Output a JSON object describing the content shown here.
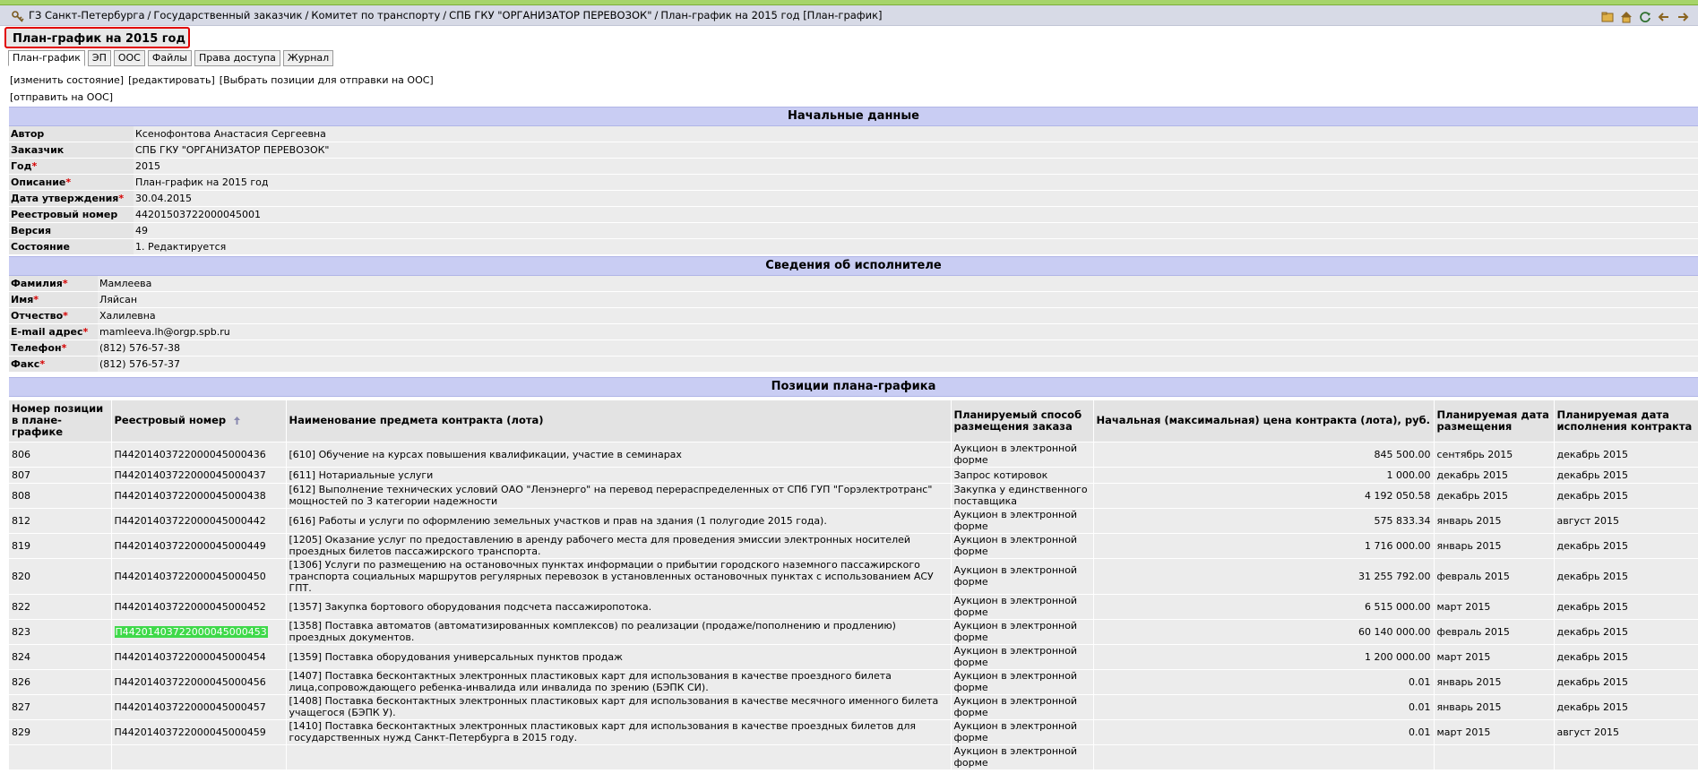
{
  "breadcrumbs": [
    "ГЗ Санкт-Петербурга",
    "Государственный заказчик",
    "Комитет по транспорту",
    "СПБ ГКУ \"ОРГАНИЗАТОР ПЕРЕВОЗОК\"",
    "План-график на 2015 год [План-график]"
  ],
  "breadcrumb_sep": "/",
  "toolbar_icons": [
    "folder-icon",
    "home-icon",
    "refresh-icon",
    "back-icon",
    "forward-icon"
  ],
  "page_title": "План-график на 2015 год",
  "tabs": [
    "План-график",
    "ЭП",
    "ООС",
    "Файлы",
    "Права доступа",
    "Журнал"
  ],
  "active_tab": "План-график",
  "actions": [
    "[изменить состояние]",
    "[редактировать]",
    "[Выбрать позиции для отправки на ООС]"
  ],
  "actions_row2": "[отправить на ООС]",
  "initial_data": {
    "title": "Начальные данные",
    "rows": [
      {
        "label": "Автор",
        "required": "",
        "value": "Ксенофонтова Анастасия Сергеевна"
      },
      {
        "label": "Заказчик",
        "required": "",
        "value": "СПБ ГКУ \"ОРГАНИЗАТОР ПЕРЕВОЗОК\""
      },
      {
        "label": "Год",
        "required": "*",
        "value": "2015"
      },
      {
        "label": "Описание",
        "required": "*",
        "value": "План-график на 2015 год"
      },
      {
        "label": "Дата утверждения",
        "required": "*",
        "value": "30.04.2015"
      },
      {
        "label": "Реестровый номер",
        "required": "",
        "value": "44201503722000045001"
      },
      {
        "label": "Версия",
        "required": "",
        "value": "49"
      },
      {
        "label": "Состояние",
        "required": "",
        "value": "1. Редактируется"
      }
    ]
  },
  "executor": {
    "title": "Сведения об исполнителе",
    "rows": [
      {
        "label": "Фамилия",
        "required": "*",
        "value": "Мамлеева"
      },
      {
        "label": "Имя",
        "required": "*",
        "value": "Ляйсан"
      },
      {
        "label": "Отчество",
        "required": "*",
        "value": "Халилевна"
      },
      {
        "label": "E-mail адрес",
        "required": "*",
        "value": "mamleeva.lh@orgp.spb.ru"
      },
      {
        "label": "Телефон",
        "required": "*",
        "value": "(812) 576-57-38"
      },
      {
        "label": "Факс",
        "required": "*",
        "value": "(812) 576-57-37"
      }
    ]
  },
  "positions": {
    "title": "Позиции плана-графика",
    "headers": [
      "Номер позиции в плане-графике",
      "Реестровый номер",
      "Наименование предмета контракта (лота)",
      "Планируемый способ размещения заказа",
      "Начальная (максимальная) цена контракта (лота), руб.",
      "Планируемая дата размещения",
      "Планируемая дата исполнения контракта"
    ],
    "rows": [
      {
        "num": "806",
        "reg": "П44201403722000045000436",
        "name": "[610] Обучение на курсах повышения квалификации, участие в семинарах",
        "method": "Аукцион в электронной форме",
        "price": "845 500.00",
        "place": "сентябрь 2015",
        "exec": "декабрь 2015",
        "highlight": false
      },
      {
        "num": "807",
        "reg": "П44201403722000045000437",
        "name": "[611] Нотариальные услуги",
        "method": "Запрос котировок",
        "price": "1 000.00",
        "place": "декабрь 2015",
        "exec": "декабрь 2015",
        "highlight": false
      },
      {
        "num": "808",
        "reg": "П44201403722000045000438",
        "name": "[612] Выполнение технических условий ОАО \"Ленэнерго\" на перевод перераспределенных от СПб ГУП \"Горэлектротранс\" мощностей по 3 категории надежности",
        "method": "Закупка у единственного поставщика",
        "price": "4 192 050.58",
        "place": "декабрь 2015",
        "exec": "декабрь 2015",
        "highlight": false
      },
      {
        "num": "812",
        "reg": "П44201403722000045000442",
        "name": "[616] Работы и услуги по оформлению земельных участков и прав на здания (1 полугодие 2015 года).",
        "method": "Аукцион в электронной форме",
        "price": "575 833.34",
        "place": "январь 2015",
        "exec": "август 2015",
        "highlight": false
      },
      {
        "num": "819",
        "reg": "П44201403722000045000449",
        "name": "[1205] Оказание услуг по предоставлению в аренду рабочего места для проведения эмиссии электронных носителей проездных билетов пассажирского транспорта.",
        "method": "Аукцион в электронной форме",
        "price": "1 716 000.00",
        "place": "январь 2015",
        "exec": "декабрь 2015",
        "highlight": false
      },
      {
        "num": "820",
        "reg": "П44201403722000045000450",
        "name": "[1306] Услуги по размещению на остановочных пунктах информации о прибытии городского наземного пассажирского транспорта социальных маршрутов регулярных перевозок в установленных остановочных пунктах с использованием АСУ ГПТ.",
        "method": "Аукцион в электронной форме",
        "price": "31 255 792.00",
        "place": "февраль 2015",
        "exec": "декабрь 2015",
        "highlight": false
      },
      {
        "num": "822",
        "reg": "П44201403722000045000452",
        "name": "[1357] Закупка бортового оборудования подсчета пассажиропотока.",
        "method": "Аукцион в электронной форме",
        "price": "6 515 000.00",
        "place": "март 2015",
        "exec": "декабрь 2015",
        "highlight": false
      },
      {
        "num": "823",
        "reg": "П44201403722000045000453",
        "name": "[1358] Поставка автоматов (автоматизированных комплексов) по реализации (продаже/пополнению и продлению) проездных документов.",
        "method": "Аукцион в электронной форме",
        "price": "60 140 000.00",
        "place": "февраль 2015",
        "exec": "декабрь 2015",
        "highlight": true
      },
      {
        "num": "824",
        "reg": "П44201403722000045000454",
        "name": "[1359] Поставка оборудования универсальных пунктов продаж",
        "method": "Аукцион в электронной форме",
        "price": "1 200 000.00",
        "place": "март 2015",
        "exec": "декабрь 2015",
        "highlight": false
      },
      {
        "num": "826",
        "reg": "П44201403722000045000456",
        "name": "[1407] Поставка бесконтактных электронных пластиковых карт для использования в качестве проездного билета лица,сопровождающего ребенка-инвалида или инвалида по зрению (БЭПК СИ).",
        "method": "Аукцион в электронной форме",
        "price": "0.01",
        "place": "январь 2015",
        "exec": "декабрь 2015",
        "highlight": false
      },
      {
        "num": "827",
        "reg": "П44201403722000045000457",
        "name": "[1408] Поставка бесконтактных электронных пластиковых карт для использования в качестве месячного именного билета учащегося (БЭПК У).",
        "method": "Аукцион в электронной форме",
        "price": "0.01",
        "place": "январь 2015",
        "exec": "декабрь 2015",
        "highlight": false
      },
      {
        "num": "829",
        "reg": "П44201403722000045000459",
        "name": "[1410] Поставка бесконтактных электронных пластиковых карт для использования в качестве проездных билетов для государственных нужд Санкт-Петербурга в 2015 году.",
        "method": "Аукцион в электронной форме",
        "price": "0.01",
        "place": "март 2015",
        "exec": "август 2015",
        "highlight": false
      },
      {
        "num": "",
        "reg": "",
        "name": "",
        "method": "Аукцион в электронной форме",
        "price": "",
        "place": "",
        "exec": "",
        "highlight": false
      }
    ]
  }
}
